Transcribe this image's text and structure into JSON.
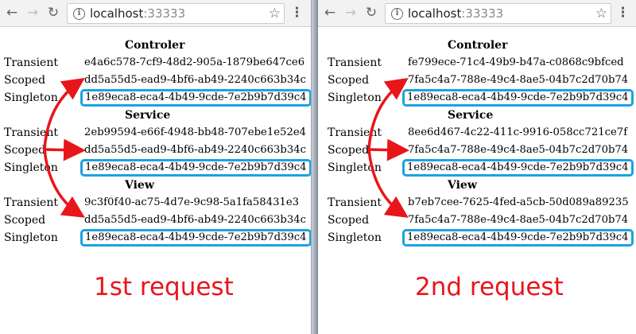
{
  "panes": [
    {
      "url_host": "localhost",
      "url_port": ":33333",
      "caption": "1st request",
      "sections": [
        {
          "title": "Controler",
          "rows": [
            {
              "label": "Transient",
              "value": "e4a6c578-7cf9-48d2-905a-1879be647ce6"
            },
            {
              "label": "Scoped",
              "value": "dd5a55d5-ead9-4bf6-ab49-2240c663b34c"
            },
            {
              "label": "Singleton",
              "value": "1e89eca8-eca4-4b49-9cde-7e2b9b7d39c4"
            }
          ]
        },
        {
          "title": "Service",
          "rows": [
            {
              "label": "Transient",
              "value": "2eb99594-e66f-4948-bb48-707ebe1e52e4"
            },
            {
              "label": "Scoped",
              "value": "dd5a55d5-ead9-4bf6-ab49-2240c663b34c"
            },
            {
              "label": "Singleton",
              "value": "1e89eca8-eca4-4b49-9cde-7e2b9b7d39c4"
            }
          ]
        },
        {
          "title": "View",
          "rows": [
            {
              "label": "Transient",
              "value": "9c3f0f40-ac75-4d7e-9c98-5a1fa58431e3"
            },
            {
              "label": "Scoped",
              "value": "dd5a55d5-ead9-4bf6-ab49-2240c663b34c"
            },
            {
              "label": "Singleton",
              "value": "1e89eca8-eca4-4b49-9cde-7e2b9b7d39c4"
            }
          ]
        }
      ]
    },
    {
      "url_host": "localhost",
      "url_port": ":33333",
      "caption": "2nd request",
      "sections": [
        {
          "title": "Controler",
          "rows": [
            {
              "label": "Transient",
              "value": "fe799ece-71c4-49b9-b47a-c0868c9bfced"
            },
            {
              "label": "Scoped",
              "value": "7fa5c4a7-788e-49c4-8ae5-04b7c2d70b74"
            },
            {
              "label": "Singleton",
              "value": "1e89eca8-eca4-4b49-9cde-7e2b9b7d39c4"
            }
          ]
        },
        {
          "title": "Service",
          "rows": [
            {
              "label": "Transient",
              "value": "8ee6d467-4c22-411c-9916-058cc721ce7f"
            },
            {
              "label": "Scoped",
              "value": "7fa5c4a7-788e-49c4-8ae5-04b7c2d70b74"
            },
            {
              "label": "Singleton",
              "value": "1e89eca8-eca4-4b49-9cde-7e2b9b7d39c4"
            }
          ]
        },
        {
          "title": "View",
          "rows": [
            {
              "label": "Transient",
              "value": "b7eb7cee-7625-4fed-a5cb-50d089a89235"
            },
            {
              "label": "Scoped",
              "value": "7fa5c4a7-788e-49c4-8ae5-04b7c2d70b74"
            },
            {
              "label": "Singleton",
              "value": "1e89eca8-eca4-4b49-9cde-7e2b9b7d39c4"
            }
          ]
        }
      ]
    }
  ],
  "icons": {
    "back": "arrow-left-icon",
    "forward": "arrow-right-icon",
    "reload": "reload-icon",
    "info": "info-icon",
    "bookmark": "star-icon",
    "menu": "kebab-menu-icon"
  },
  "colors": {
    "highlight_box": "#1aa3e0",
    "annotation": "#e8151b"
  }
}
